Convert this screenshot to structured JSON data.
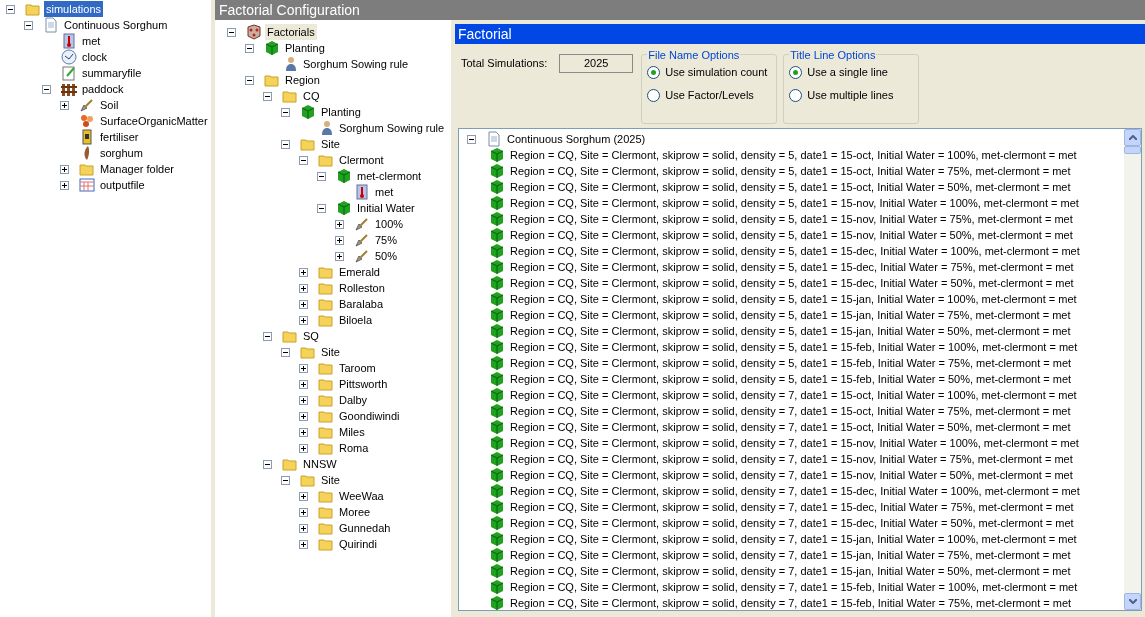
{
  "simulations_tree": [
    {
      "label": "simulations",
      "kind": "folder",
      "selected": true,
      "expanded": true,
      "children": [
        {
          "label": "Continuous Sorghum",
          "kind": "document",
          "selected": false,
          "expanded": true,
          "children": [
            {
              "label": "met",
              "kind": "thermometer",
              "selected": false
            },
            {
              "label": "clock",
              "kind": "clock",
              "selected": false
            },
            {
              "label": "summaryfile",
              "kind": "notepad",
              "selected": false
            },
            {
              "label": "paddock",
              "kind": "fence",
              "selected": false,
              "expanded": true,
              "children": [
                {
                  "label": "Soil",
                  "kind": "shovel",
                  "selected": false,
                  "expanded": false
                },
                {
                  "label": "SurfaceOrganicMatter",
                  "kind": "organic",
                  "selected": false
                },
                {
                  "label": "fertiliser",
                  "kind": "fertiliser",
                  "selected": false
                },
                {
                  "label": "sorghum",
                  "kind": "plant",
                  "selected": false
                },
                {
                  "label": "Manager folder",
                  "kind": "folder",
                  "selected": false,
                  "expanded": false
                },
                {
                  "label": "outputfile",
                  "kind": "table",
                  "selected": false,
                  "expanded": false
                }
              ]
            }
          ]
        }
      ]
    }
  ],
  "title": "Factorial Configuration",
  "factorial_tree": [
    {
      "label": "Factorials",
      "kind": "factorial",
      "selected": true,
      "expanded": true,
      "children": [
        {
          "label": "Planting",
          "kind": "cube",
          "selected": false,
          "expanded": true,
          "children": [
            {
              "label": "Sorghum Sowing rule",
              "kind": "rule",
              "selected": false
            }
          ]
        },
        {
          "label": "Region",
          "kind": "folder",
          "selected": false,
          "expanded": true,
          "children": [
            {
              "label": "CQ",
              "kind": "folder",
              "selected": false,
              "expanded": true,
              "children": [
                {
                  "label": "Planting",
                  "kind": "cube",
                  "selected": false,
                  "expanded": true,
                  "children": [
                    {
                      "label": "Sorghum Sowing rule",
                      "kind": "rule",
                      "selected": false
                    }
                  ]
                },
                {
                  "label": "Site",
                  "kind": "folder",
                  "selected": false,
                  "expanded": true,
                  "children": [
                    {
                      "label": "Clermont",
                      "kind": "folder",
                      "selected": false,
                      "expanded": true,
                      "children": [
                        {
                          "label": "met-clermont",
                          "kind": "cube",
                          "selected": false,
                          "expanded": true,
                          "children": [
                            {
                              "label": "met",
                              "kind": "thermometer",
                              "selected": false
                            }
                          ]
                        },
                        {
                          "label": "Initial Water",
                          "kind": "cube",
                          "selected": false,
                          "expanded": true,
                          "children": [
                            {
                              "label": "100%",
                              "kind": "shovel",
                              "selected": false,
                              "expanded": false
                            },
                            {
                              "label": "75%",
                              "kind": "shovel",
                              "selected": false,
                              "expanded": false
                            },
                            {
                              "label": "50%",
                              "kind": "shovel",
                              "selected": false,
                              "expanded": false
                            }
                          ]
                        }
                      ]
                    },
                    {
                      "label": "Emerald",
                      "kind": "folder",
                      "selected": false,
                      "expanded": false
                    },
                    {
                      "label": "Rolleston",
                      "kind": "folder",
                      "selected": false,
                      "expanded": false
                    },
                    {
                      "label": "Baralaba",
                      "kind": "folder",
                      "selected": false,
                      "expanded": false
                    },
                    {
                      "label": "Biloela",
                      "kind": "folder",
                      "selected": false,
                      "expanded": false
                    }
                  ]
                }
              ]
            },
            {
              "label": "SQ",
              "kind": "folder",
              "selected": false,
              "expanded": true,
              "children": [
                {
                  "label": "Site",
                  "kind": "folder",
                  "selected": false,
                  "expanded": true,
                  "children": [
                    {
                      "label": "Taroom",
                      "kind": "folder",
                      "selected": false,
                      "expanded": false
                    },
                    {
                      "label": "Pittsworth",
                      "kind": "folder",
                      "selected": false,
                      "expanded": false
                    },
                    {
                      "label": "Dalby",
                      "kind": "folder",
                      "selected": false,
                      "expanded": false
                    },
                    {
                      "label": "Goondiwindi",
                      "kind": "folder",
                      "selected": false,
                      "expanded": false
                    },
                    {
                      "label": "Miles",
                      "kind": "folder",
                      "selected": false,
                      "expanded": false
                    },
                    {
                      "label": "Roma",
                      "kind": "folder",
                      "selected": false,
                      "expanded": false
                    }
                  ]
                }
              ]
            },
            {
              "label": "NNSW",
              "kind": "folder",
              "selected": false,
              "expanded": true,
              "children": [
                {
                  "label": "Site",
                  "kind": "folder",
                  "selected": false,
                  "expanded": true,
                  "children": [
                    {
                      "label": "WeeWaa",
                      "kind": "folder",
                      "selected": false,
                      "expanded": false
                    },
                    {
                      "label": "Moree",
                      "kind": "folder",
                      "selected": false,
                      "expanded": false
                    },
                    {
                      "label": "Gunnedah",
                      "kind": "folder",
                      "selected": false,
                      "expanded": false
                    },
                    {
                      "label": "Quirindi",
                      "kind": "folder",
                      "selected": false,
                      "expanded": false
                    }
                  ]
                }
              ]
            }
          ]
        }
      ]
    }
  ],
  "panel": {
    "header": "Factorial",
    "total_label": "Total Simulations:",
    "total_value": "2025",
    "file_name_options": {
      "legend": "File Name Options",
      "options": [
        {
          "label": "Use simulation count",
          "selected": true
        },
        {
          "label": "Use Factor/Levels",
          "selected": false
        }
      ]
    },
    "title_line_options": {
      "legend": "Title Line Options",
      "options": [
        {
          "label": "Use a single line",
          "selected": true
        },
        {
          "label": "Use multiple lines",
          "selected": false
        }
      ]
    }
  },
  "simulation_list": {
    "root": {
      "label": "Continuous Sorghum (2025)",
      "expanded": true
    },
    "rows": [
      "Region = CQ, Site = Clermont, skiprow = solid, density = 5, date1 = 15-oct, Initial Water = 100%, met-clermont = met",
      "Region = CQ, Site = Clermont, skiprow = solid, density = 5, date1 = 15-oct, Initial Water = 75%, met-clermont = met",
      "Region = CQ, Site = Clermont, skiprow = solid, density = 5, date1 = 15-oct, Initial Water = 50%, met-clermont = met",
      "Region = CQ, Site = Clermont, skiprow = solid, density = 5, date1 = 15-nov, Initial Water = 100%, met-clermont = met",
      "Region = CQ, Site = Clermont, skiprow = solid, density = 5, date1 = 15-nov, Initial Water = 75%, met-clermont = met",
      "Region = CQ, Site = Clermont, skiprow = solid, density = 5, date1 = 15-nov, Initial Water = 50%, met-clermont = met",
      "Region = CQ, Site = Clermont, skiprow = solid, density = 5, date1 = 15-dec, Initial Water = 100%, met-clermont = met",
      "Region = CQ, Site = Clermont, skiprow = solid, density = 5, date1 = 15-dec, Initial Water = 75%, met-clermont = met",
      "Region = CQ, Site = Clermont, skiprow = solid, density = 5, date1 = 15-dec, Initial Water = 50%, met-clermont = met",
      "Region = CQ, Site = Clermont, skiprow = solid, density = 5, date1 = 15-jan, Initial Water = 100%, met-clermont = met",
      "Region = CQ, Site = Clermont, skiprow = solid, density = 5, date1 = 15-jan, Initial Water = 75%, met-clermont = met",
      "Region = CQ, Site = Clermont, skiprow = solid, density = 5, date1 = 15-jan, Initial Water = 50%, met-clermont = met",
      "Region = CQ, Site = Clermont, skiprow = solid, density = 5, date1 = 15-feb, Initial Water = 100%, met-clermont = met",
      "Region = CQ, Site = Clermont, skiprow = solid, density = 5, date1 = 15-feb, Initial Water = 75%, met-clermont = met",
      "Region = CQ, Site = Clermont, skiprow = solid, density = 5, date1 = 15-feb, Initial Water = 50%, met-clermont = met",
      "Region = CQ, Site = Clermont, skiprow = solid, density = 7, date1 = 15-oct, Initial Water = 100%, met-clermont = met",
      "Region = CQ, Site = Clermont, skiprow = solid, density = 7, date1 = 15-oct, Initial Water = 75%, met-clermont = met",
      "Region = CQ, Site = Clermont, skiprow = solid, density = 7, date1 = 15-oct, Initial Water = 50%, met-clermont = met",
      "Region = CQ, Site = Clermont, skiprow = solid, density = 7, date1 = 15-nov, Initial Water = 100%, met-clermont = met",
      "Region = CQ, Site = Clermont, skiprow = solid, density = 7, date1 = 15-nov, Initial Water = 75%, met-clermont = met",
      "Region = CQ, Site = Clermont, skiprow = solid, density = 7, date1 = 15-nov, Initial Water = 50%, met-clermont = met",
      "Region = CQ, Site = Clermont, skiprow = solid, density = 7, date1 = 15-dec, Initial Water = 100%, met-clermont = met",
      "Region = CQ, Site = Clermont, skiprow = solid, density = 7, date1 = 15-dec, Initial Water = 75%, met-clermont = met",
      "Region = CQ, Site = Clermont, skiprow = solid, density = 7, date1 = 15-dec, Initial Water = 50%, met-clermont = met",
      "Region = CQ, Site = Clermont, skiprow = solid, density = 7, date1 = 15-jan, Initial Water = 100%, met-clermont = met",
      "Region = CQ, Site = Clermont, skiprow = solid, density = 7, date1 = 15-jan, Initial Water = 75%, met-clermont = met",
      "Region = CQ, Site = Clermont, skiprow = solid, density = 7, date1 = 15-jan, Initial Water = 50%, met-clermont = met",
      "Region = CQ, Site = Clermont, skiprow = solid, density = 7, date1 = 15-feb, Initial Water = 100%, met-clermont = met",
      "Region = CQ, Site = Clermont, skiprow = solid, density = 7, date1 = 15-feb, Initial Water = 75%, met-clermont = met"
    ]
  }
}
